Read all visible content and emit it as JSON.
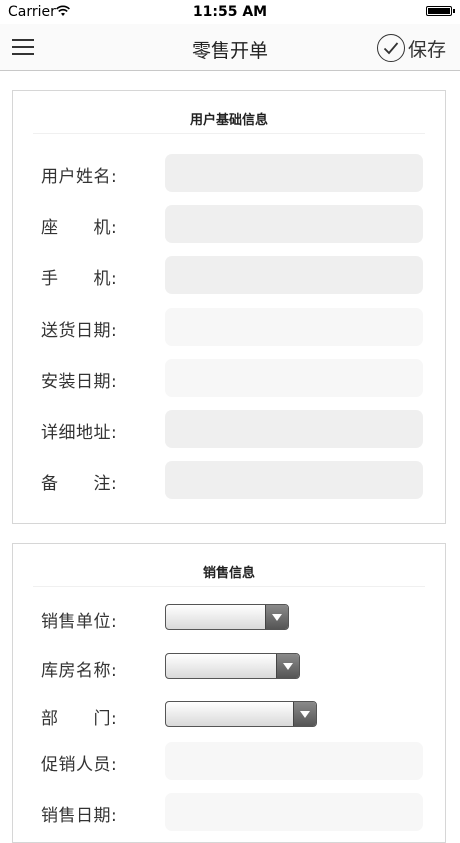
{
  "status_bar": {
    "carrier": "Carrier",
    "time": "11:55 AM"
  },
  "nav": {
    "title": "零售开单",
    "save_label": "保存",
    "icons": {
      "menu": "hamburger-menu-icon",
      "save": "checkmark-circle-icon"
    }
  },
  "basic_info": {
    "title": "用户基础信息",
    "fields": [
      {
        "label": "用户姓名:",
        "value": ""
      },
      {
        "label": "座　　机:",
        "value": ""
      },
      {
        "label": "手　　机:",
        "value": ""
      },
      {
        "label": "送货日期:",
        "value": ""
      },
      {
        "label": "安装日期:",
        "value": ""
      },
      {
        "label": "详细地址:",
        "value": ""
      },
      {
        "label": "备　　注:",
        "value": ""
      }
    ]
  },
  "sales_info": {
    "title": "销售信息",
    "fields": [
      {
        "label": "销售单位:",
        "value": ""
      },
      {
        "label": "库房名称:",
        "value": ""
      },
      {
        "label": "部　　门:",
        "value": ""
      },
      {
        "label": "促销人员:",
        "value": ""
      },
      {
        "label": "销售日期:",
        "value": ""
      }
    ]
  }
}
